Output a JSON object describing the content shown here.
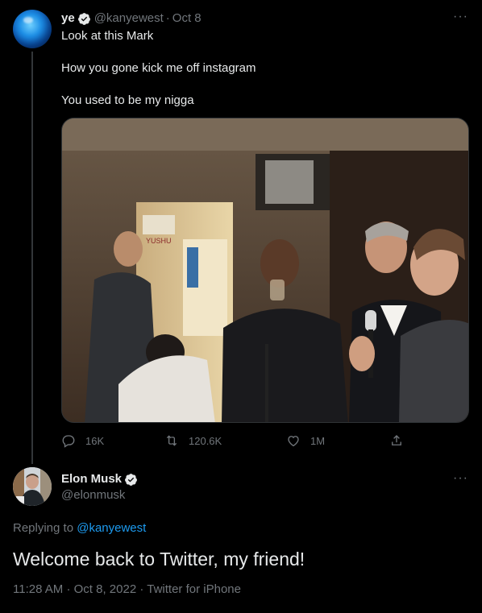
{
  "parent_tweet": {
    "author_name": "ye",
    "author_handle": "@kanyewest",
    "separator": "·",
    "date": "Oct 8",
    "lines": [
      "Look at this Mark",
      "How you gone kick me off instagram",
      "You used to be my nigga"
    ],
    "media_sign_text": "YUSHU",
    "stats": {
      "replies": "16K",
      "retweets": "120.6K",
      "likes": "1M"
    },
    "colors": {
      "verified": "#1d9bf0"
    }
  },
  "reply_tweet": {
    "author_name": "Elon Musk",
    "author_handle": "@elonmusk",
    "replying_prefix": "Replying to",
    "replying_to": "@kanyewest",
    "text": "Welcome back to Twitter, my friend!",
    "time": "11:28 AM",
    "separator": "·",
    "date": "Oct 8, 2022",
    "source": "Twitter for iPhone"
  },
  "icons": {
    "more": "more-icon",
    "reply": "reply-icon",
    "retweet": "retweet-icon",
    "like": "like-icon",
    "share": "share-icon"
  },
  "theme": {
    "background": "#000000",
    "text": "#e7e9ea",
    "muted": "#71767b",
    "accent": "#1d9bf0"
  }
}
